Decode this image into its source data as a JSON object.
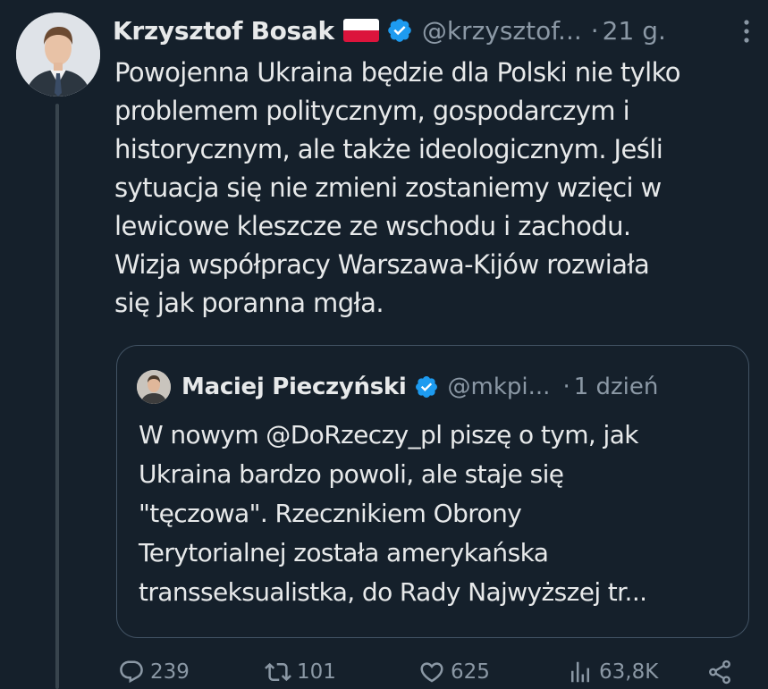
{
  "tweet": {
    "author_name": "Krzysztof Bosak",
    "flag": "Polish flag",
    "handle": "@krzysztof...",
    "separator": "·",
    "time": "21 g.",
    "text_lines": [
      "Powojenna Ukraina będzie dla Polski nie tylko",
      "problemem politycznym, gospodarczym i",
      "historycznym, ale także ideologicznym. Jeśli",
      "sytuacja się nie zmieni zostaniemy wzięci w",
      "lewicowe kleszcze ze wschodu i zachodu.",
      "Wizja współpracy Warszawa-Kijów rozwiała",
      "się jak poranna mgła."
    ]
  },
  "quote": {
    "author_name": "Maciej Pieczyński",
    "handle": "@mkpi...",
    "separator": "·",
    "time": "1 dzień",
    "text_lines": [
      "W nowym @DoRzeczy_pl piszę o tym, jak",
      "Ukraina bardzo powoli, ale staje się",
      "\"tęczowa\". Rzecznikiem Obrony",
      "Terytorialnej została amerykańska",
      "transseksualistka, do Rady Najwyższej tr..."
    ]
  },
  "actions": {
    "replies": "239",
    "retweets": "101",
    "likes": "625",
    "views": "63,8K"
  },
  "colors": {
    "background": "#15202b",
    "text": "#e7e9ea",
    "secondary": "#8b98a5",
    "verified": "#1d9bf0",
    "border": "#425364"
  },
  "icons": [
    "verified-icon",
    "more-icon",
    "reply-icon",
    "retweet-icon",
    "like-icon",
    "views-icon",
    "share-icon"
  ]
}
